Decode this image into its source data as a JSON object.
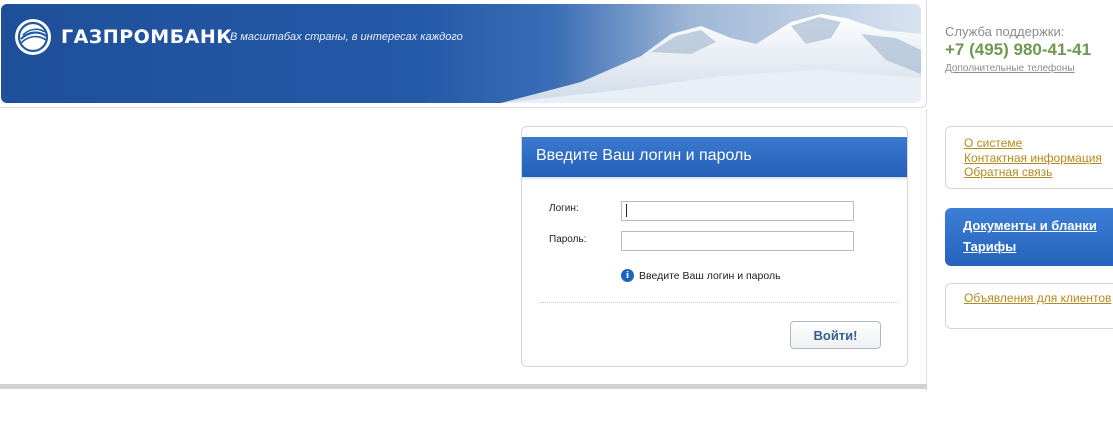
{
  "header": {
    "logo_text": "ГАЗПРОМБАНК",
    "slogan": "В масштабах страны, в интересах каждого",
    "banner_color": "#2459a8"
  },
  "support": {
    "label": "Служба поддержки:",
    "phone": "+7 (495) 980-41-41",
    "more_phones_link": "Дополнительные телефоны"
  },
  "login": {
    "title": "Введите Ваш логин и пароль",
    "login_label": "Логин:",
    "login_value": "",
    "password_label": "Пароль:",
    "password_value": "",
    "hint_icon": "info-icon",
    "hint_text": "Введите Ваш логин и пароль",
    "submit_label": "Войти!"
  },
  "side": {
    "links_box": [
      "О системе",
      "Контактная информация",
      "Обратная связь"
    ],
    "highlight_box": [
      "Документы и бланки",
      "Тарифы"
    ],
    "announcements_link": "Объявления для клиентов"
  },
  "colors": {
    "accent_blue": "#2560b8",
    "link_gold": "#b38a1e",
    "phone_green": "#6e9a4f"
  }
}
